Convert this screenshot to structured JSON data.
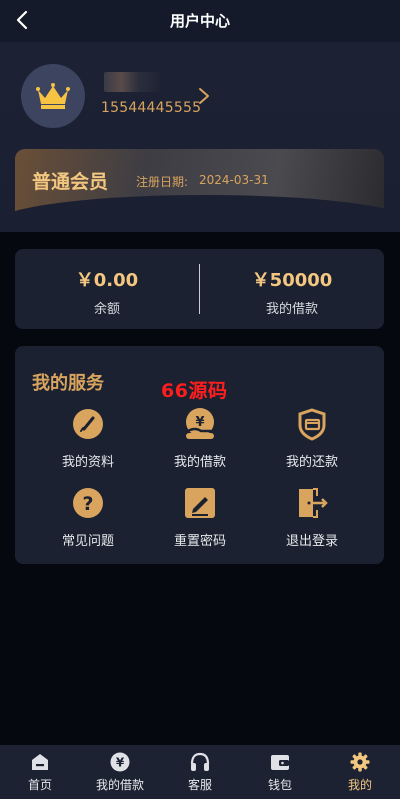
{
  "header": {
    "title": "用户中心"
  },
  "user": {
    "phone": "15544445555"
  },
  "membership": {
    "level": "普通会员",
    "reg_label": "注册日期:",
    "reg_date": "2024-03-31"
  },
  "balance": {
    "balance_value": "￥0.00",
    "balance_label": "余额",
    "loan_value": "￥50000",
    "loan_label": "我的借款"
  },
  "services": {
    "title": "我的服务",
    "watermark": "66源码",
    "items": [
      {
        "label": "我的资料",
        "icon": "edit-circle-icon"
      },
      {
        "label": "我的借款",
        "icon": "yen-hand-icon"
      },
      {
        "label": "我的还款",
        "icon": "card-shield-icon"
      },
      {
        "label": "常见问题",
        "icon": "question-icon"
      },
      {
        "label": "重置密码",
        "icon": "pen-square-icon"
      },
      {
        "label": "退出登录",
        "icon": "logout-icon"
      }
    ]
  },
  "nav": {
    "items": [
      {
        "label": "首页",
        "icon": "home-icon"
      },
      {
        "label": "我的借款",
        "icon": "yen-icon"
      },
      {
        "label": "客服",
        "icon": "headset-icon"
      },
      {
        "label": "钱包",
        "icon": "wallet-icon"
      },
      {
        "label": "我的",
        "icon": "gear-icon"
      }
    ],
    "active_index": 4
  },
  "colors": {
    "accent": "#d9a45e",
    "gold_text": "#f3c780",
    "card_bg": "#1b2130",
    "page_bg": "#05080f"
  }
}
